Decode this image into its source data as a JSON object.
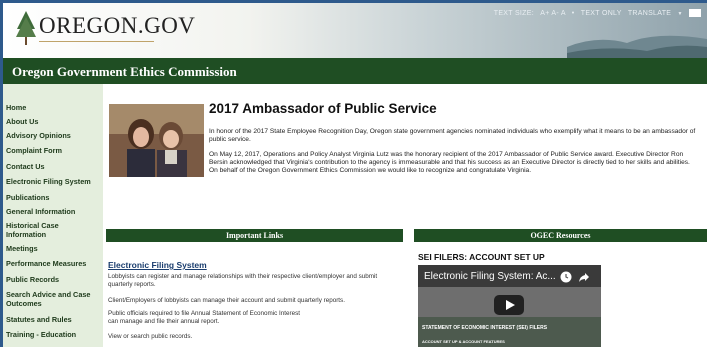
{
  "header": {
    "logo": "OREGON.GOV",
    "text_size_label": "TEXT SIZE:",
    "text_size_options": "A+ A- A",
    "separator": "•",
    "text_only": "TEXT ONLY",
    "translate": "TRANSLATE",
    "translate_arrow": "▼"
  },
  "site_title": "Oregon Government Ethics Commission",
  "sidebar": {
    "items": [
      {
        "label": "Home"
      },
      {
        "label": "About Us"
      },
      {
        "label": "Advisory Opinions"
      },
      {
        "label": "Complaint Form"
      },
      {
        "label": "Contact Us"
      },
      {
        "label": "Electronic Filing System"
      },
      {
        "label": "Publications"
      },
      {
        "label": "General Information"
      },
      {
        "label": "Historical Case Information"
      },
      {
        "label": "Meetings"
      },
      {
        "label": "Performance Measures"
      },
      {
        "label": "Public Records"
      },
      {
        "label": "Search Advice and Case Outcomes"
      },
      {
        "label": "Statutes and Rules"
      },
      {
        "label": "Training - Education"
      }
    ]
  },
  "main": {
    "title": "2017 Ambassador of Public Service",
    "paragraph1": "In honor of the 2017 State Employee Recognition Day, Oregon state government agencies nominated individuals who exemplify what it means to be an ambassador of public service.",
    "paragraph2": "On May 12, 2017, Operations and Policy Analyst Virginia Lutz was the honorary recipient of the 2017 Ambassador of Public Service award.  Executive Director Ron Bersin acknowledged that Virginia's contribution to the agency is immeasurable and that his success as an Executive Director is directly tied to her skills and abilities.  On behalf of the Oregon Government Ethics Commission we would like to recognize and congratulate Virginia."
  },
  "important_links": {
    "heading": "Important Links",
    "section_title": "Electronic Filing System",
    "lines": [
      "Lobbyists can register and manage relationships with their respective client/employer and submit quarterly reports.",
      "Client/Employers of lobbyists can manage their account and submit quarterly reports.",
      "Public officials required to file Annual Statement of Economic Interest can manage and file their annual report.",
      "View or search public records."
    ]
  },
  "resources": {
    "heading": "OGEC Resources",
    "sei_title": "SEI FILERS: ACCOUNT SET UP",
    "video_title": "Electronic Filing System: Ac...",
    "video_caption1": "STATEMENT OF ECONOMIC INTEREST (SEI) FILERS",
    "video_caption2": "ACCOUNT SET UP & ACCOUNT FEATURES"
  },
  "colors": {
    "brand_green": "#1f4e23",
    "sidebar_bg": "#e4eedd",
    "link_blue": "#1a3d6e"
  }
}
